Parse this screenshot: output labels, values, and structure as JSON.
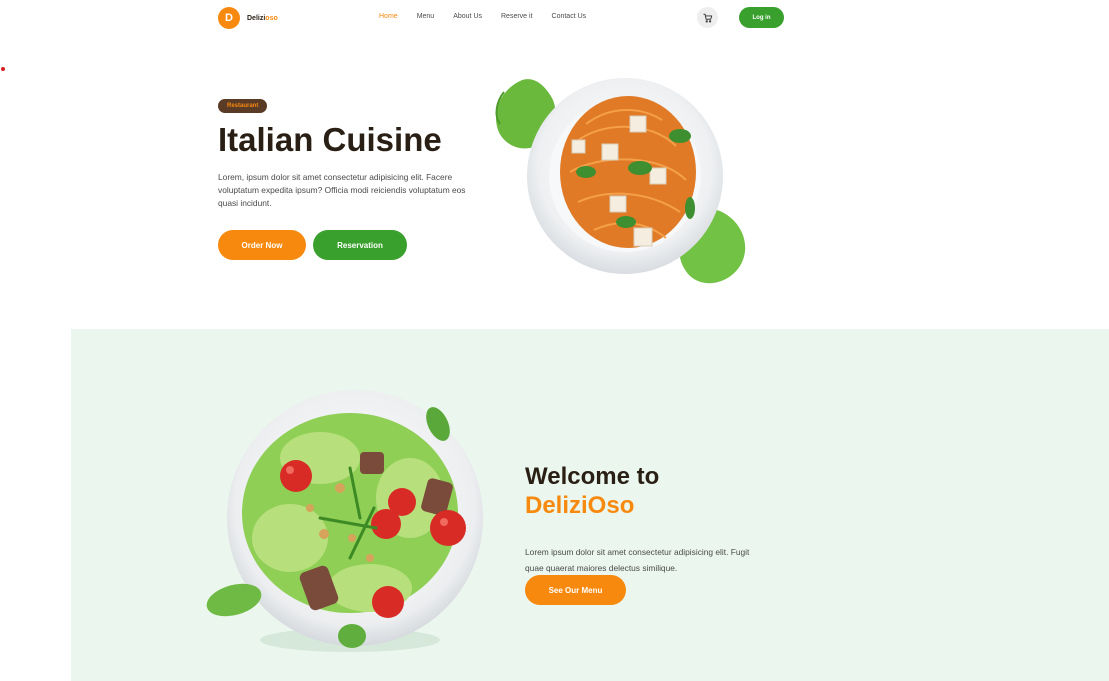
{
  "nav": {
    "logo_letter": "D",
    "logo_name_main": "Delizi",
    "logo_name_accent": "oso",
    "links": [
      "Home",
      "Menu",
      "About Us",
      "Reserve it",
      "Contact Us"
    ],
    "active_link": "Home",
    "login_label": "Log in"
  },
  "hero": {
    "badge": "Restaurant",
    "title": "Italian Cuisine",
    "description": "Lorem, ipsum dolor sit amet consectetur adipisicing elit. Facere voluptatum expedita ipsum? Officia modi reiciendis voluptatum eos quasi incidunt.",
    "order_label": "Order Now",
    "reserve_label": "Reservation"
  },
  "welcome": {
    "title": "Welcome to",
    "brand": "DeliziOso",
    "description": "Lorem ipsum dolor sit amet consectetur adipisicing elit. Fugit quae quaerat maiores delectus similique.",
    "menu_label": "See Our Menu"
  },
  "colors": {
    "accent": "#f7890e",
    "green": "#3aa02d",
    "dark": "#2a1f14",
    "section_bg": "#ebf7ee"
  },
  "icons": {
    "cart": "cart-icon"
  }
}
